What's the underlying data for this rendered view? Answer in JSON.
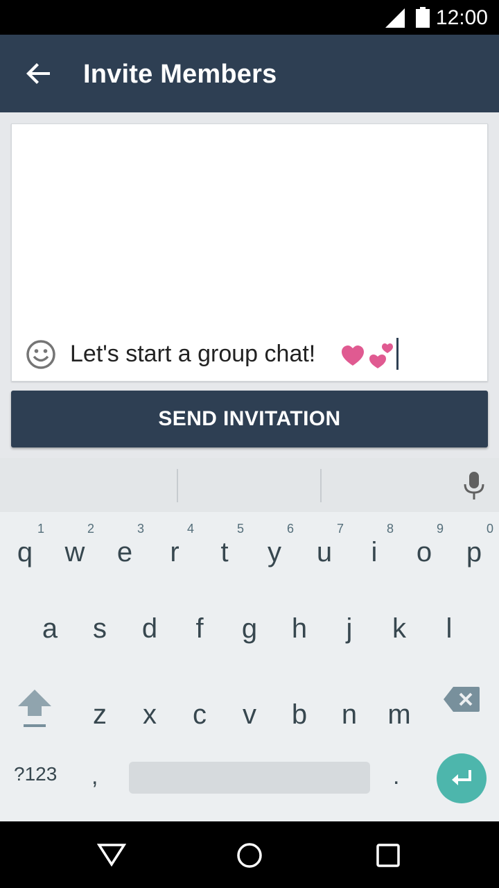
{
  "status_bar": {
    "time": "12:00"
  },
  "app_bar": {
    "title": "Invite Members"
  },
  "message": {
    "text": "Let's start a group chat!"
  },
  "actions": {
    "send_label": "SEND INVITATION"
  },
  "keyboard": {
    "row1": [
      {
        "ch": "q",
        "hint": "1"
      },
      {
        "ch": "w",
        "hint": "2"
      },
      {
        "ch": "e",
        "hint": "3"
      },
      {
        "ch": "r",
        "hint": "4"
      },
      {
        "ch": "t",
        "hint": "5"
      },
      {
        "ch": "y",
        "hint": "6"
      },
      {
        "ch": "u",
        "hint": "7"
      },
      {
        "ch": "i",
        "hint": "8"
      },
      {
        "ch": "o",
        "hint": "9"
      },
      {
        "ch": "p",
        "hint": "0"
      }
    ],
    "row2": [
      "a",
      "s",
      "d",
      "f",
      "g",
      "h",
      "j",
      "k",
      "l"
    ],
    "row3": [
      "z",
      "x",
      "c",
      "v",
      "b",
      "n",
      "m"
    ],
    "symbols_label": "?123",
    "comma": ",",
    "period": "."
  },
  "colors": {
    "primary": "#2e3f53",
    "accent": "#4db6ac",
    "heart": "#e05a91"
  },
  "icons": [
    "signal-icon",
    "battery-icon",
    "back-arrow-icon",
    "emoji-icon",
    "heart-icon",
    "mic-icon",
    "shift-icon",
    "backspace-icon",
    "enter-icon",
    "nav-back-icon",
    "nav-home-icon",
    "nav-recents-icon"
  ]
}
